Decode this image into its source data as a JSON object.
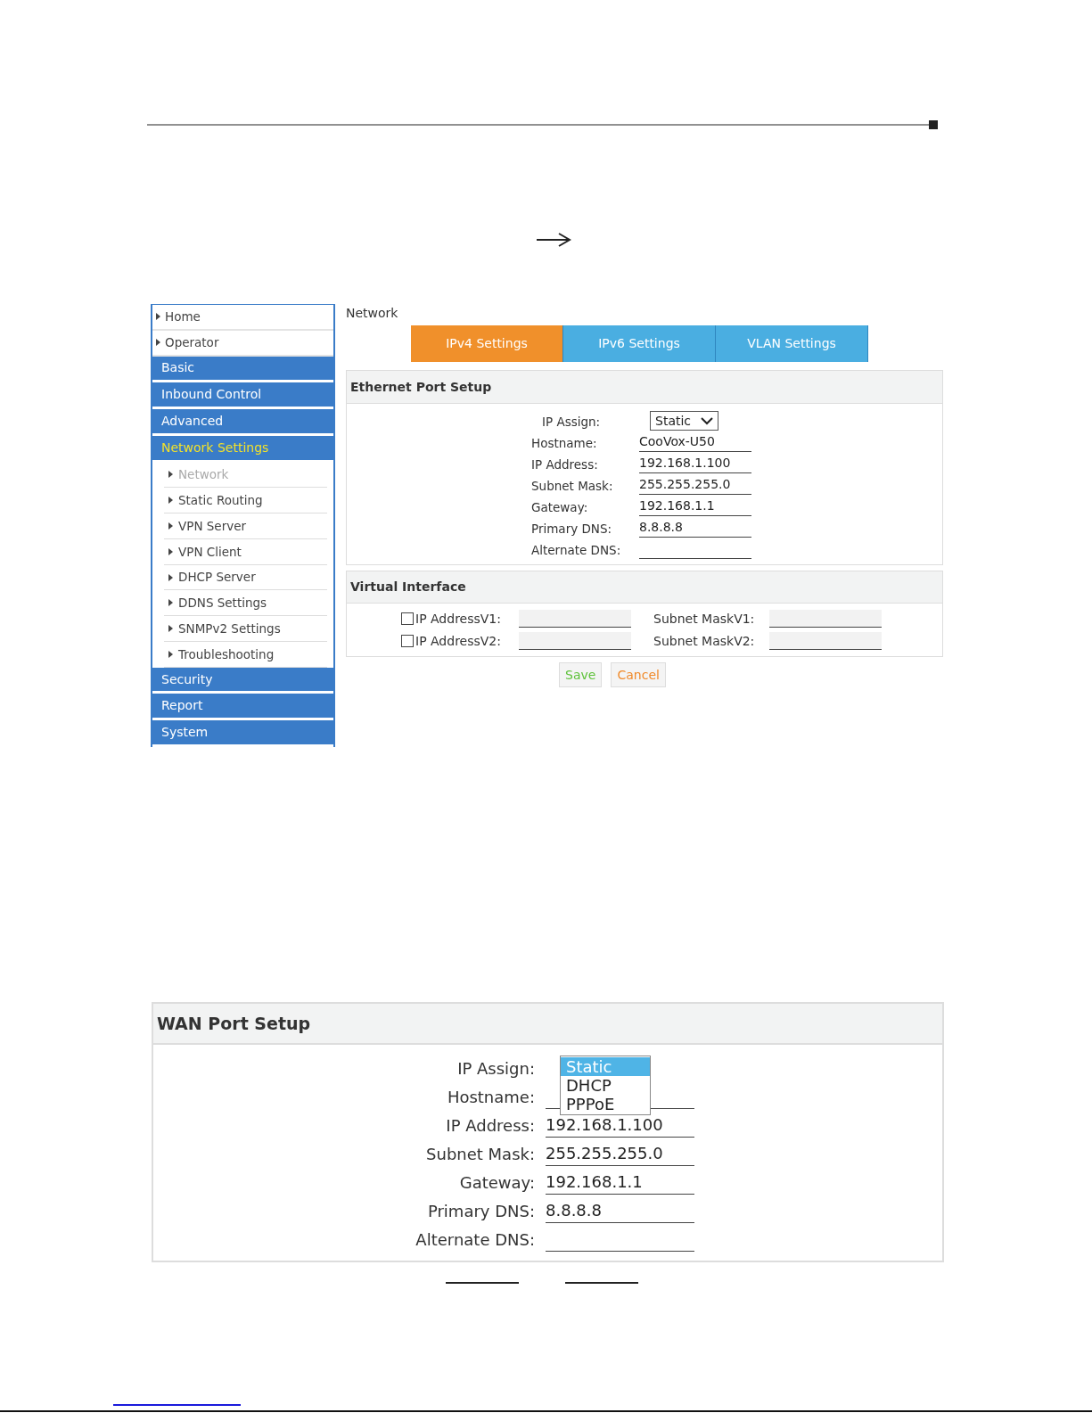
{
  "sidebar": {
    "items": [
      {
        "label": "Home",
        "kind": "link",
        "selected": false
      },
      {
        "label": "Operator",
        "kind": "link",
        "selected": false
      },
      {
        "label": "Basic",
        "kind": "section",
        "selected": false
      },
      {
        "label": "Inbound Control",
        "kind": "section",
        "selected": false
      },
      {
        "label": "Advanced",
        "kind": "section",
        "selected": false
      },
      {
        "label": "Network Settings",
        "kind": "section",
        "selected": true
      },
      {
        "label": "Network",
        "kind": "subitem",
        "selected": true
      },
      {
        "label": "Static Routing",
        "kind": "subitem",
        "selected": false
      },
      {
        "label": "VPN Server",
        "kind": "subitem",
        "selected": false
      },
      {
        "label": "VPN Client",
        "kind": "subitem",
        "selected": false
      },
      {
        "label": "DHCP Server",
        "kind": "subitem",
        "selected": false
      },
      {
        "label": "DDNS Settings",
        "kind": "subitem",
        "selected": false
      },
      {
        "label": "SNMPv2 Settings",
        "kind": "subitem",
        "selected": false
      },
      {
        "label": "Troubleshooting",
        "kind": "subitem",
        "selected": false
      },
      {
        "label": "Security",
        "kind": "section",
        "selected": false
      },
      {
        "label": "Report",
        "kind": "section",
        "selected": false
      },
      {
        "label": "System",
        "kind": "section",
        "selected": false
      }
    ]
  },
  "breadcrumb": "Network",
  "tabs": [
    {
      "label": "IPv4 Settings",
      "selected": true
    },
    {
      "label": "IPv6 Settings",
      "selected": false
    },
    {
      "label": "VLAN Settings",
      "selected": false
    }
  ],
  "ethernet": {
    "title": "Ethernet Port Setup",
    "fields": [
      {
        "label": "IP Assign:",
        "kind": "select",
        "value": "Static"
      },
      {
        "label": "Hostname:",
        "kind": "text",
        "value": "CooVox-U50"
      },
      {
        "label": "IP Address:",
        "kind": "text",
        "value": "192.168.1.100"
      },
      {
        "label": "Subnet Mask:",
        "kind": "text",
        "value": "255.255.255.0"
      },
      {
        "label": "Gateway:",
        "kind": "text",
        "value": "192.168.1.1"
      },
      {
        "label": "Primary DNS:",
        "kind": "text",
        "value": "8.8.8.8"
      },
      {
        "label": "Alternate DNS:",
        "kind": "text"
      }
    ]
  },
  "virtual": {
    "title": "Virtual Interface",
    "rows": [
      {
        "checked": false,
        "address_label": "IP AddressV1:",
        "mask_label": "Subnet MaskV1:"
      },
      {
        "checked": false,
        "address_label": "IP AddressV2:",
        "mask_label": "Subnet MaskV2:"
      }
    ]
  },
  "buttons": [
    {
      "label": "Save",
      "kind": "save"
    },
    {
      "label": "Cancel",
      "kind": "cancel"
    }
  ],
  "wan": {
    "title": "WAN Port Setup",
    "fields": [
      {
        "label": "IP Assign:",
        "kind": "dropdown",
        "options": [
          {
            "label": "Static",
            "selected": true
          },
          {
            "label": "DHCP",
            "selected": false
          },
          {
            "label": "PPPoE",
            "selected": false
          }
        ]
      },
      {
        "label": "Hostname:",
        "kind": "text"
      },
      {
        "label": "IP Address:",
        "kind": "text",
        "value": "192.168.1.100"
      },
      {
        "label": "Subnet Mask:",
        "kind": "text",
        "value": "255.255.255.0"
      },
      {
        "label": "Gateway:",
        "kind": "text",
        "value": "192.168.1.1"
      },
      {
        "label": "Primary DNS:",
        "kind": "text",
        "value": "8.8.8.8"
      },
      {
        "label": "Alternate DNS:",
        "kind": "text"
      }
    ]
  }
}
